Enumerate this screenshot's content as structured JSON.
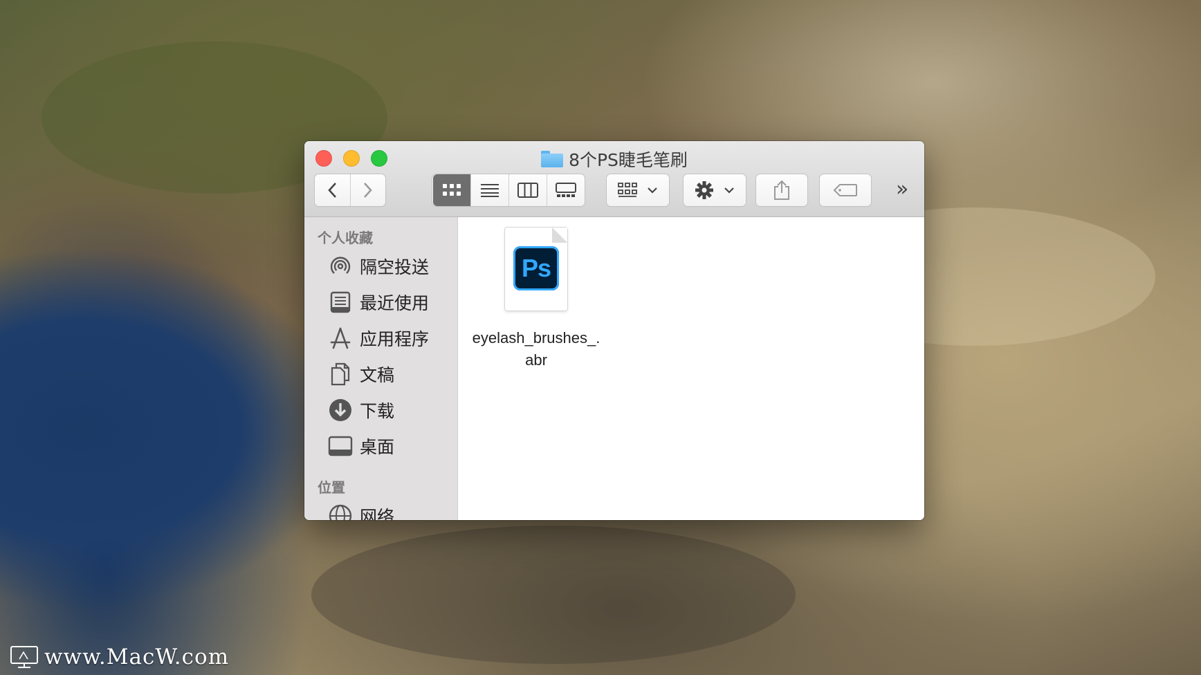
{
  "window": {
    "title": "8个PS睫毛笔刷",
    "title_icon": "folder-icon"
  },
  "toolbar": {
    "back": "‹",
    "forward": "›",
    "view_modes": [
      "icon-view",
      "list-view",
      "column-view",
      "gallery-view"
    ],
    "active_view": "icon-view",
    "overflow": "»"
  },
  "sidebar": {
    "favorites_header": "个人收藏",
    "items": [
      {
        "label": "隔空投送",
        "icon": "airdrop-icon"
      },
      {
        "label": "最近使用",
        "icon": "recents-icon"
      },
      {
        "label": "应用程序",
        "icon": "applications-icon"
      },
      {
        "label": "文稿",
        "icon": "documents-icon"
      },
      {
        "label": "下载",
        "icon": "downloads-icon"
      },
      {
        "label": "桌面",
        "icon": "desktop-icon"
      }
    ],
    "locations_header": "位置",
    "locations": [
      {
        "label": "网络",
        "icon": "network-icon"
      }
    ]
  },
  "files": [
    {
      "name_line1": "eyelash_brushes_.",
      "name_line2": "abr",
      "icon_text": "Ps"
    }
  ],
  "watermark": "www.MacW.com",
  "colors": {
    "close": "#fe5f57",
    "minimize": "#febc2e",
    "maximize": "#28c840",
    "ps_blue": "#31a8ff"
  }
}
